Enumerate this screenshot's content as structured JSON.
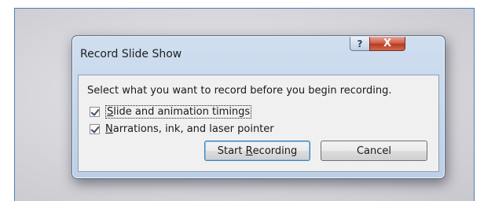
{
  "dialog": {
    "title": "Record Slide Show",
    "help_glyph": "?",
    "close_glyph": "X",
    "prompt": "Select what you want to record before you begin recording.",
    "options": [
      {
        "pre": "",
        "accel": "S",
        "post": "lide and animation timings",
        "checked": true
      },
      {
        "pre": "",
        "accel": "N",
        "post": "arrations, ink, and laser pointer",
        "checked": true
      }
    ],
    "start_button": {
      "pre": "Start ",
      "accel": "R",
      "post": "ecording"
    },
    "cancel_label": "Cancel"
  }
}
